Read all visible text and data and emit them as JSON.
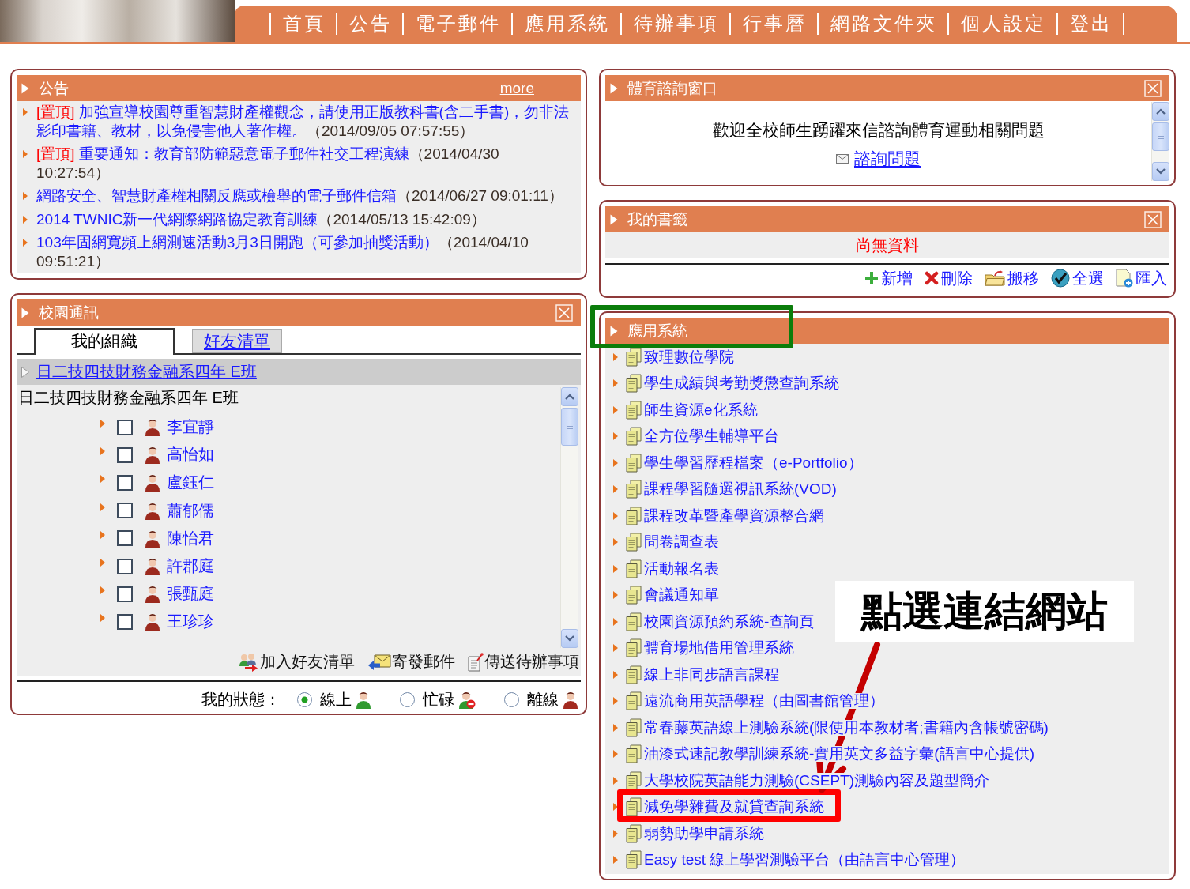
{
  "nav_menu": [
    "首頁",
    "公告",
    "電子郵件",
    "應用系統",
    "待辦事項",
    "行事曆",
    "網路文件夾",
    "個人設定",
    "登出"
  ],
  "announcements": {
    "title": "公告",
    "more_link": "more",
    "items": [
      {
        "tag": "[置頂]",
        "title": "加強宣導校園尊重智慧財產權觀念，請使用正版教科書(含二手書)，勿非法影印書籍、教材，以免侵害他人著作權。",
        "time": "（2014/09/05 07:57:55）"
      },
      {
        "tag": "[置頂]",
        "title": "重要通知：教育部防範惡意電子郵件社交工程演練",
        "time": "（2014/04/30 10:27:54）"
      },
      {
        "title": "網路安全、智慧財產權相關反應或檢舉的電子郵件信箱",
        "time": "（2014/06/27 09:01:11）"
      },
      {
        "title": "2014 TWNIC新一代網際網路協定教育訓練",
        "time": "（2014/05/13 15:42:09）"
      },
      {
        "title": "103年固網寬頻上網測速活動3月3日開跑（可參加抽獎活動）",
        "time": "（2014/04/10 09:51:21）"
      }
    ]
  },
  "campus_messaging": {
    "title": "校園通訊",
    "closable": true,
    "tabs": [
      {
        "label": "我的組織",
        "selected": true
      },
      {
        "label": "好友清單",
        "selected": false
      }
    ],
    "group_link": "日二技四技財務金融系四年 E班",
    "group_heading": "日二技四技財務金融系四年 E班",
    "members": [
      {
        "name": "李宜靜",
        "checked": false
      },
      {
        "name": "高怡如",
        "checked": false
      },
      {
        "name": "盧鈺仁",
        "checked": false
      },
      {
        "name": "蕭郁儒",
        "checked": false
      },
      {
        "name": "陳怡君",
        "checked": false
      },
      {
        "name": "許郡庭",
        "checked": false
      },
      {
        "name": "張甄庭",
        "checked": false
      },
      {
        "name": "王珍珍",
        "checked": false
      }
    ],
    "actions": [
      {
        "kind": "add_friend",
        "label": "加入好友清單"
      },
      {
        "kind": "mail",
        "label": "寄發郵件"
      },
      {
        "kind": "todo",
        "label": "傳送待辦事項"
      }
    ],
    "status": {
      "label": "我的狀態：",
      "options": [
        {
          "kind": "online",
          "label": "線上",
          "selected": true
        },
        {
          "kind": "busy",
          "label": "忙碌",
          "selected": false
        },
        {
          "kind": "offline",
          "label": "離線",
          "selected": false
        }
      ]
    }
  },
  "sports_consulting": {
    "title": "體育諮詢窗口",
    "closable": true,
    "message": "歡迎全校師生踴躍來信諮詢體育運動相關問題",
    "link": "諮詢問題"
  },
  "bookmarks": {
    "title": "我的書籤",
    "closable": true,
    "empty_message": "尚無資料",
    "actions": [
      {
        "kind": "add",
        "label": "新增"
      },
      {
        "kind": "delete",
        "label": "刪除"
      },
      {
        "kind": "move",
        "label": "搬移"
      },
      {
        "kind": "select_all",
        "label": "全選"
      },
      {
        "kind": "import",
        "label": "匯入"
      }
    ]
  },
  "applications": {
    "title": "應用系統",
    "highlighted": true,
    "items": [
      {
        "label": "致理數位學院",
        "highlighted": false
      },
      {
        "label": "學生成績與考勤獎懲查詢系統",
        "highlighted": false
      },
      {
        "label": "師生資源e化系統",
        "highlighted": false
      },
      {
        "label": "全方位學生輔導平台",
        "highlighted": false
      },
      {
        "label": "學生學習歷程檔案（e-Portfolio）",
        "highlighted": false
      },
      {
        "label": "課程學習隨選視訊系統(VOD)",
        "highlighted": false
      },
      {
        "label": "課程改革暨產學資源整合網",
        "highlighted": false
      },
      {
        "label": "問卷調查表",
        "highlighted": false
      },
      {
        "label": "活動報名表",
        "highlighted": false
      },
      {
        "label": "會議通知單",
        "highlighted": false
      },
      {
        "label": "校園資源預約系統-查詢頁",
        "highlighted": false
      },
      {
        "label": "體育場地借用管理系統",
        "highlighted": false
      },
      {
        "label": "線上非同步語言課程",
        "highlighted": false
      },
      {
        "label": "遠流商用英語學程（由圖書館管理）",
        "highlighted": false
      },
      {
        "label": "常春藤英語線上測驗系統(限使用本教材者;書籍內含帳號密碼)",
        "highlighted": false
      },
      {
        "label": "油漆式速記教學訓練系統-實用英文多益字彙(語言中心提供)",
        "highlighted": false
      },
      {
        "label": "大學校院英語能力測驗(CSEPT)測驗內容及題型簡介",
        "highlighted": false
      },
      {
        "label": "減免學雜費及就貸查詢系統",
        "highlighted": true,
        "callout": "點選連結網站"
      },
      {
        "label": "弱勢助學申請系統",
        "highlighted": false
      },
      {
        "label": "Easy test 線上學習測驗平台（由語言中心管理）",
        "highlighted": false
      }
    ]
  }
}
